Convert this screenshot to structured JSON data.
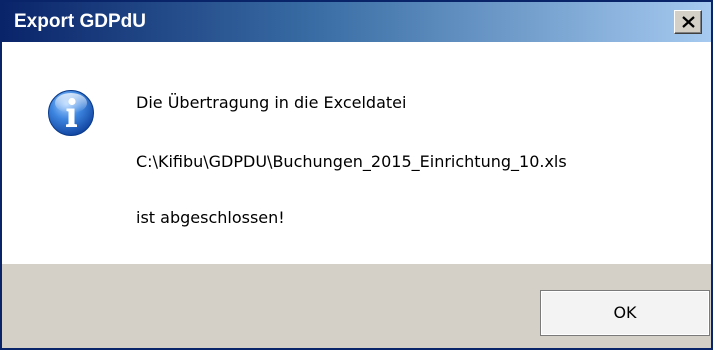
{
  "window": {
    "title": "Export GDPdU",
    "close_icon": "close-x-icon"
  },
  "message": {
    "icon": "info-icon",
    "line1": "Die Übertragung in die Exceldatei",
    "line2": "C:\\Kifibu\\GDPDU\\Buchungen_2015_Einrichtung_10.xls",
    "line3": "ist abgeschlossen!"
  },
  "buttons": {
    "ok_label": "OK"
  },
  "colors": {
    "titlebar_start": "#0a246a",
    "titlebar_end": "#a6caf0",
    "dialog_face": "#d4d0c8",
    "content_bg": "#ffffff",
    "icon_blue": "#1f5fbf"
  }
}
